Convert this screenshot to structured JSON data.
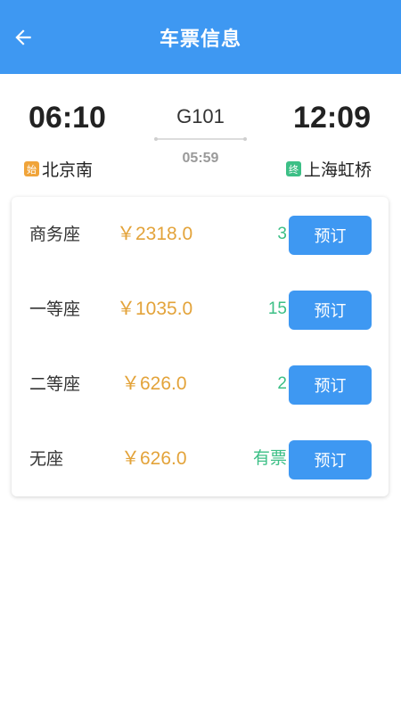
{
  "header": {
    "title": "车票信息",
    "back_icon": "arrow-left-icon",
    "background": "#3e98f2"
  },
  "trip": {
    "departure_time": "06:10",
    "arrival_time": "12:09",
    "train_number": "G101",
    "duration": "05:59",
    "from_tag": "始",
    "from_station": "北京南",
    "from_tag_color": "#f0a43a",
    "to_tag": "终",
    "to_station": "上海虹桥",
    "to_tag_color": "#3cbf86"
  },
  "seats": [
    {
      "name": "商务座",
      "price": "￥2318.0",
      "available": "3",
      "book_label": "预订"
    },
    {
      "name": "一等座",
      "price": "￥1035.0",
      "available": "15",
      "book_label": "预订"
    },
    {
      "name": "二等座",
      "price": "￥626.0",
      "available": "2",
      "book_label": "预订"
    },
    {
      "name": "无座",
      "price": "￥626.0",
      "available": "有票",
      "book_label": "预订"
    }
  ],
  "colors": {
    "accent": "#3e98f2",
    "price": "#e3a33a",
    "availability": "#3cbf86"
  }
}
